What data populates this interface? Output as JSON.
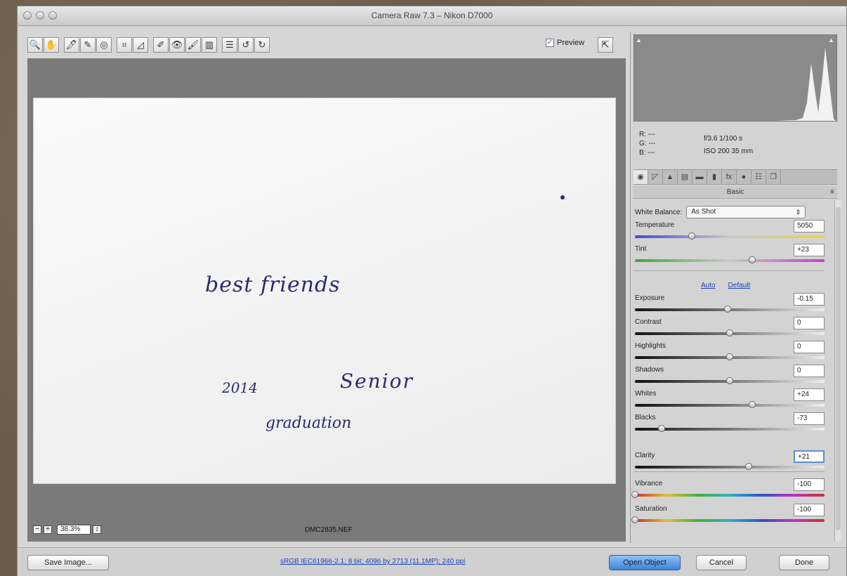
{
  "window": {
    "title": "Camera Raw 7.3  –  Nikon D7000"
  },
  "toolbar": {
    "tools": [
      {
        "name": "zoom-tool-icon",
        "glyph": "🔍"
      },
      {
        "name": "hand-tool-icon",
        "glyph": "✋"
      },
      {
        "name": "white-balance-tool-icon",
        "glyph": "🖊"
      },
      {
        "name": "color-sampler-tool-icon",
        "glyph": "✎"
      },
      {
        "name": "targeted-adjustment-tool-icon",
        "glyph": "◎"
      },
      {
        "name": "crop-tool-icon",
        "glyph": "⌗"
      },
      {
        "name": "straighten-tool-icon",
        "glyph": "◿"
      },
      {
        "name": "spot-removal-tool-icon",
        "glyph": "✐"
      },
      {
        "name": "red-eye-tool-icon",
        "glyph": "👁"
      },
      {
        "name": "adjustment-brush-icon",
        "glyph": "🖌"
      },
      {
        "name": "graduated-filter-icon",
        "glyph": "▥"
      },
      {
        "name": "preferences-icon",
        "glyph": "☰"
      },
      {
        "name": "rotate-left-icon",
        "glyph": "↺"
      },
      {
        "name": "rotate-right-icon",
        "glyph": "↻"
      }
    ],
    "preview_label": "Preview",
    "preview_checked": true
  },
  "image": {
    "text1": "best friends",
    "text2": "2014",
    "text3": "Senior",
    "text4": "graduation",
    "zoom": "38.3%",
    "filename": "DMC2835.NEF"
  },
  "info": {
    "r": "R: ---",
    "g": "G: ---",
    "b": "B: ---",
    "aperture_shutter": "f/3.6   1/100 s",
    "iso_focal": "ISO 200   35 mm"
  },
  "panel": {
    "title": "Basic",
    "white_balance_label": "White Balance:",
    "white_balance_value": "As Shot",
    "auto_label": "Auto",
    "default_label": "Default",
    "controls": [
      {
        "key": "temperature",
        "label": "Temperature",
        "value": "5050",
        "pos": 0.3,
        "track": "temp"
      },
      {
        "key": "tint",
        "label": "Tint",
        "value": "+23",
        "pos": 0.62,
        "track": "tint"
      },
      {
        "key": "exposure",
        "label": "Exposure",
        "value": "-0.15",
        "pos": 0.49,
        "track": "tone"
      },
      {
        "key": "contrast",
        "label": "Contrast",
        "value": "0",
        "pos": 0.5,
        "track": "tone"
      },
      {
        "key": "highlights",
        "label": "Highlights",
        "value": "0",
        "pos": 0.5,
        "track": "tone"
      },
      {
        "key": "shadows",
        "label": "Shadows",
        "value": "0",
        "pos": 0.5,
        "track": "tone"
      },
      {
        "key": "whites",
        "label": "Whites",
        "value": "+24",
        "pos": 0.62,
        "track": "tone"
      },
      {
        "key": "blacks",
        "label": "Blacks",
        "value": "-73",
        "pos": 0.14,
        "track": "tone"
      },
      {
        "key": "clarity",
        "label": "Clarity",
        "value": "+21",
        "pos": 0.6,
        "track": "tone",
        "focus": true
      },
      {
        "key": "vibrance",
        "label": "Vibrance",
        "value": "-100",
        "pos": 0.0,
        "track": "color"
      },
      {
        "key": "saturation",
        "label": "Saturation",
        "value": "-100",
        "pos": 0.0,
        "track": "color"
      }
    ]
  },
  "bottom": {
    "save_label": "Save Image...",
    "workflow_text": "sRGB IEC61966-2.1; 8 bit; 4096 by 2713 (11.1MP); 240 ppi",
    "open_label": "Open Object",
    "cancel_label": "Cancel",
    "done_label": "Done"
  },
  "colors": {
    "accent": "#3c84d9",
    "handwriting": "#2c2a6e"
  }
}
